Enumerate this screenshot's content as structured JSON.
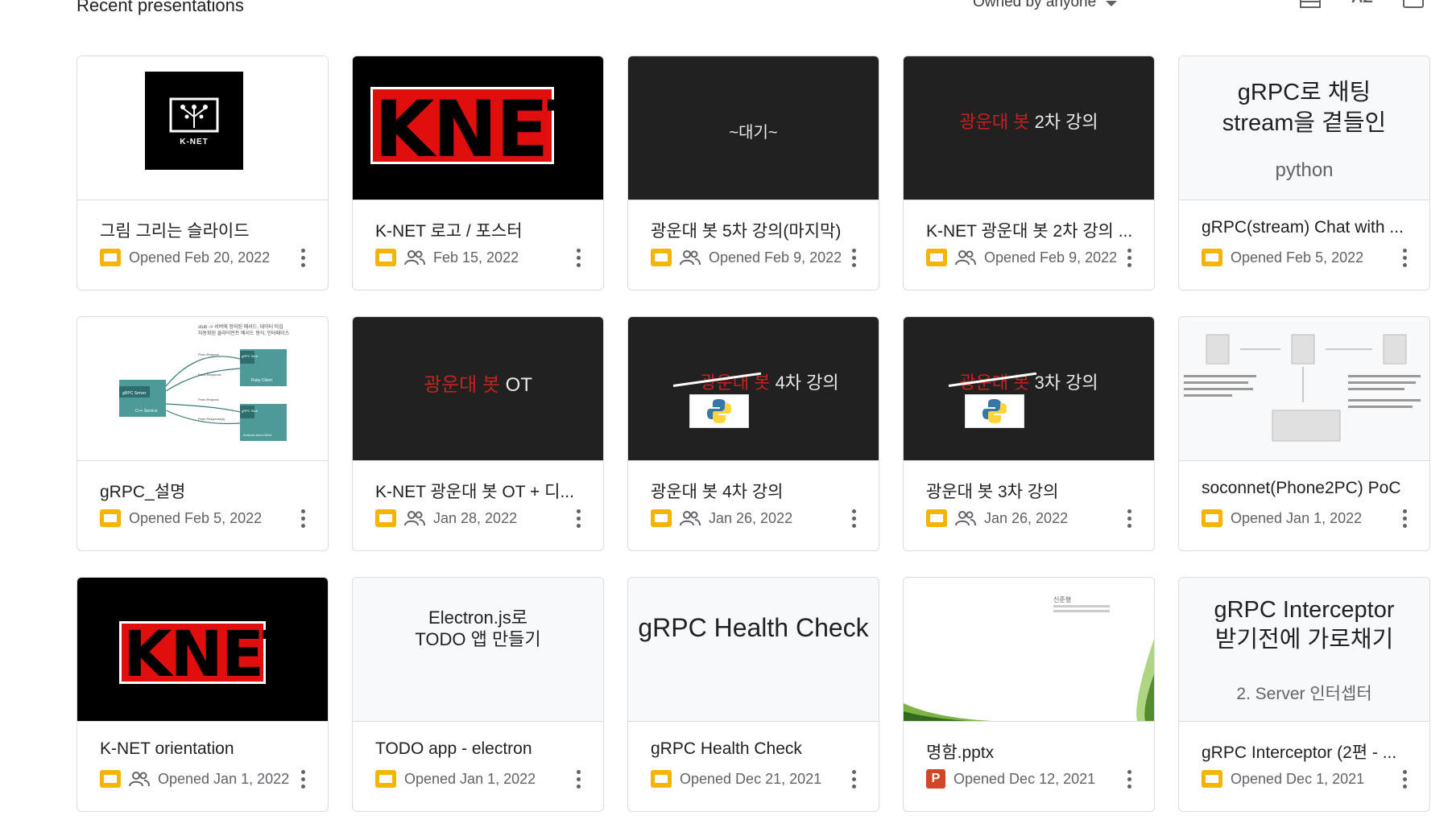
{
  "header": {
    "title": "Recent presentations",
    "owner_filter": "Owned by anyone",
    "sort_label": "AZ",
    "icons": [
      "list-view-icon",
      "sort-az-icon",
      "folder-icon"
    ]
  },
  "colors": {
    "slides_yellow": "#f4b400",
    "pptx_orange": "#d24726",
    "meta_gray": "#5f6368",
    "thumb_dark": "#212121"
  },
  "cards": [
    {
      "title": "그림 그리는 슬라이드",
      "date": "Opened Feb 20, 2022",
      "shared": false,
      "file_icon": "slides-icon",
      "thumb": {
        "label": "K-NET"
      }
    },
    {
      "title": "K-NET 로고 / 포스터",
      "date": "Feb 15, 2022",
      "shared": true,
      "file_icon": "slides-icon",
      "thumb": {
        "label": "KNET"
      }
    },
    {
      "title": "광운대 봇 5차 강의(마지막)",
      "date": "Opened Feb 9, 2022",
      "shared": true,
      "file_icon": "slides-icon",
      "thumb": {
        "label": "~대기~"
      }
    },
    {
      "title": "K-NET 광운대 봇 2차 강의 ...",
      "date": "Opened Feb 9, 2022",
      "shared": true,
      "file_icon": "slides-icon",
      "thumb": {
        "label_red": "광운대 봇",
        "label": "2차 강의"
      }
    },
    {
      "title": "gRPC(stream) Chat with ...",
      "date": "Opened Feb 5, 2022",
      "shared": false,
      "file_icon": "slides-icon",
      "thumb": {
        "line1": "gRPC로 채팅",
        "line2": "stream을 곁들인",
        "line3": "python"
      }
    },
    {
      "title": "gRPC_설명",
      "date": "Opened Feb 5, 2022",
      "shared": false,
      "file_icon": "slides-icon",
      "thumb": {
        "caption": "stub -> 서버에 정의된 메서드, 데이터 타입",
        "caption2": "자동화된 클라이언트 메서드 형식, 인터페이스",
        "server": "gRPC Server",
        "server_sub": "C++ Service",
        "stub1": "gRPC Stub",
        "client1": "Ruby Client",
        "stub2": "gRPC Stub",
        "client2": "Android-Java Client",
        "req1": "Proto Request",
        "res1": "Proto Response",
        "req2": "Proto Request",
        "res2": "Proto Response(s)"
      }
    },
    {
      "title": "K-NET 광운대 봇 OT + 디...",
      "date": "Jan 28, 2022",
      "shared": true,
      "file_icon": "slides-icon",
      "thumb": {
        "label_red": "광운대 봇",
        "label": "OT"
      }
    },
    {
      "title": "광운대 봇 4차 강의",
      "date": "Jan 26, 2022",
      "shared": true,
      "file_icon": "slides-icon",
      "thumb": {
        "label_red": "광운대 봇",
        "label": "4차 강의"
      }
    },
    {
      "title": "광운대 봇 3차 강의",
      "date": "Jan 26, 2022",
      "shared": true,
      "file_icon": "slides-icon",
      "thumb": {
        "label_red": "광운대 봇",
        "label": "3차 강의"
      }
    },
    {
      "title": "soconnet(Phone2PC) PoC",
      "date": "Opened Jan 1, 2022",
      "shared": false,
      "file_icon": "slides-icon",
      "thumb": {}
    },
    {
      "title": "K-NET orientation",
      "date": "Opened Jan 1, 2022",
      "shared": true,
      "file_icon": "slides-icon",
      "thumb": {
        "label": "KNET"
      }
    },
    {
      "title": "TODO app - electron",
      "date": "Opened Jan 1, 2022",
      "shared": false,
      "file_icon": "slides-icon",
      "thumb": {
        "line1": "Electron.js로",
        "line2": "TODO 앱 만들기"
      }
    },
    {
      "title": "gRPC Health Check",
      "date": "Opened Dec 21, 2021",
      "shared": false,
      "file_icon": "slides-icon",
      "thumb": {
        "label": "gRPC Health Check"
      }
    },
    {
      "title": "명함.pptx",
      "date": "Opened Dec 12, 2021",
      "shared": false,
      "file_icon": "pptx-icon",
      "thumb": {
        "name": "신준형"
      }
    },
    {
      "title": "gRPC Interceptor (2편 - ...",
      "date": "Opened Dec 1, 2021",
      "shared": false,
      "file_icon": "slides-icon",
      "thumb": {
        "line1": "gRPC Interceptor",
        "line2": "받기전에 가로채기",
        "line3": "2. Server 인터셉터"
      }
    }
  ]
}
